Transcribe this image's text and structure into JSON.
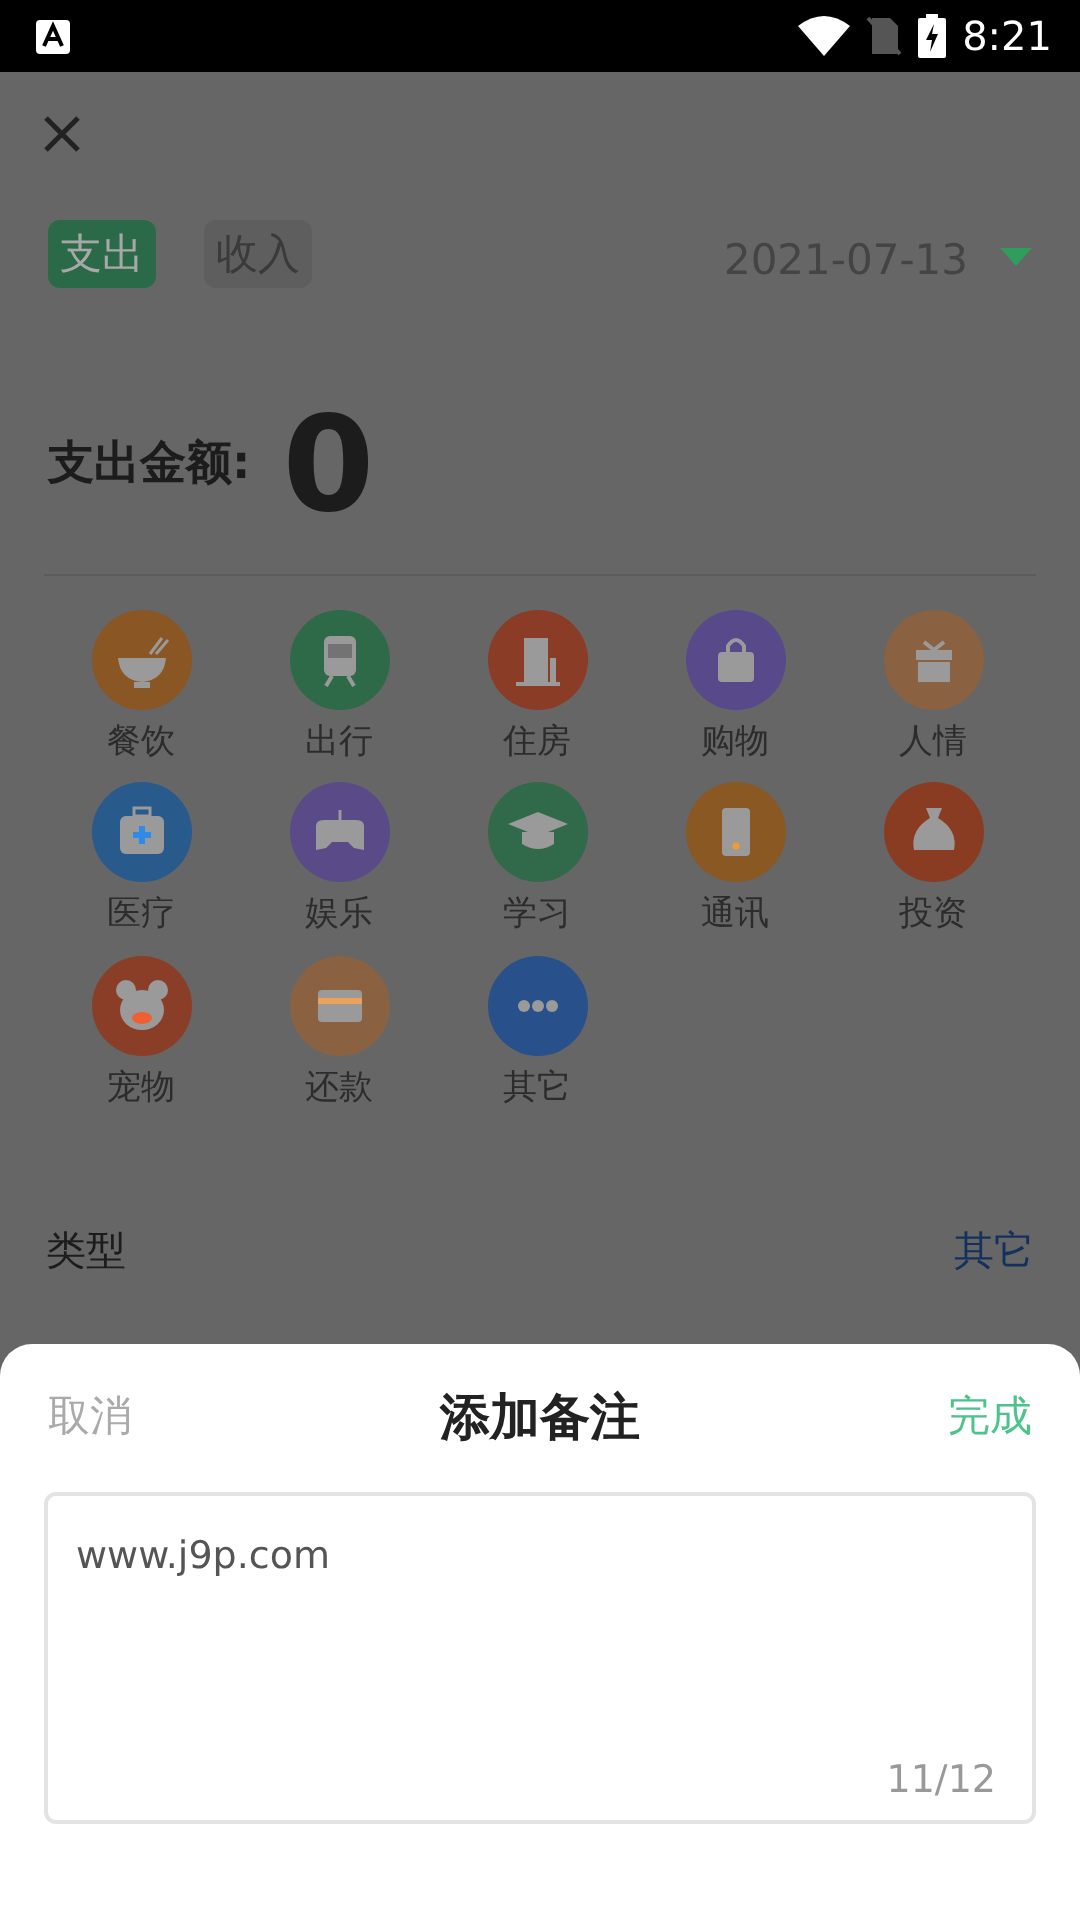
{
  "status_bar": {
    "time": "8:21"
  },
  "type_tabs": [
    {
      "label": "支出",
      "selected": true
    },
    {
      "label": "收入",
      "selected": false
    }
  ],
  "date": "2021-07-13",
  "amount": {
    "label": "支出金额:",
    "value": "0"
  },
  "categories": [
    {
      "label": "餐饮",
      "color": "#8a5624"
    },
    {
      "label": "出行",
      "color": "#2e6a48"
    },
    {
      "label": "住房",
      "color": "#8a3c26"
    },
    {
      "label": "购物",
      "color": "#584a8a"
    },
    {
      "label": "人情",
      "color": "#8a6242"
    },
    {
      "label": "医疗",
      "color": "#285a8c"
    },
    {
      "label": "娱乐",
      "color": "#5a4a88"
    },
    {
      "label": "学习",
      "color": "#306a4a"
    },
    {
      "label": "通讯",
      "color": "#8a5822"
    },
    {
      "label": "投资",
      "color": "#8a3c22"
    },
    {
      "label": "宠物",
      "color": "#8a3e28"
    },
    {
      "label": "还款",
      "color": "#8a6242"
    },
    {
      "label": "其它",
      "color": "#28508a"
    }
  ],
  "fields": [
    {
      "label": "类型",
      "value": "其它"
    }
  ],
  "sheet": {
    "cancel": "取消",
    "title": "添加备注",
    "done": "完成",
    "note": {
      "value": "www.j9p.com",
      "counter": "11/12"
    }
  }
}
